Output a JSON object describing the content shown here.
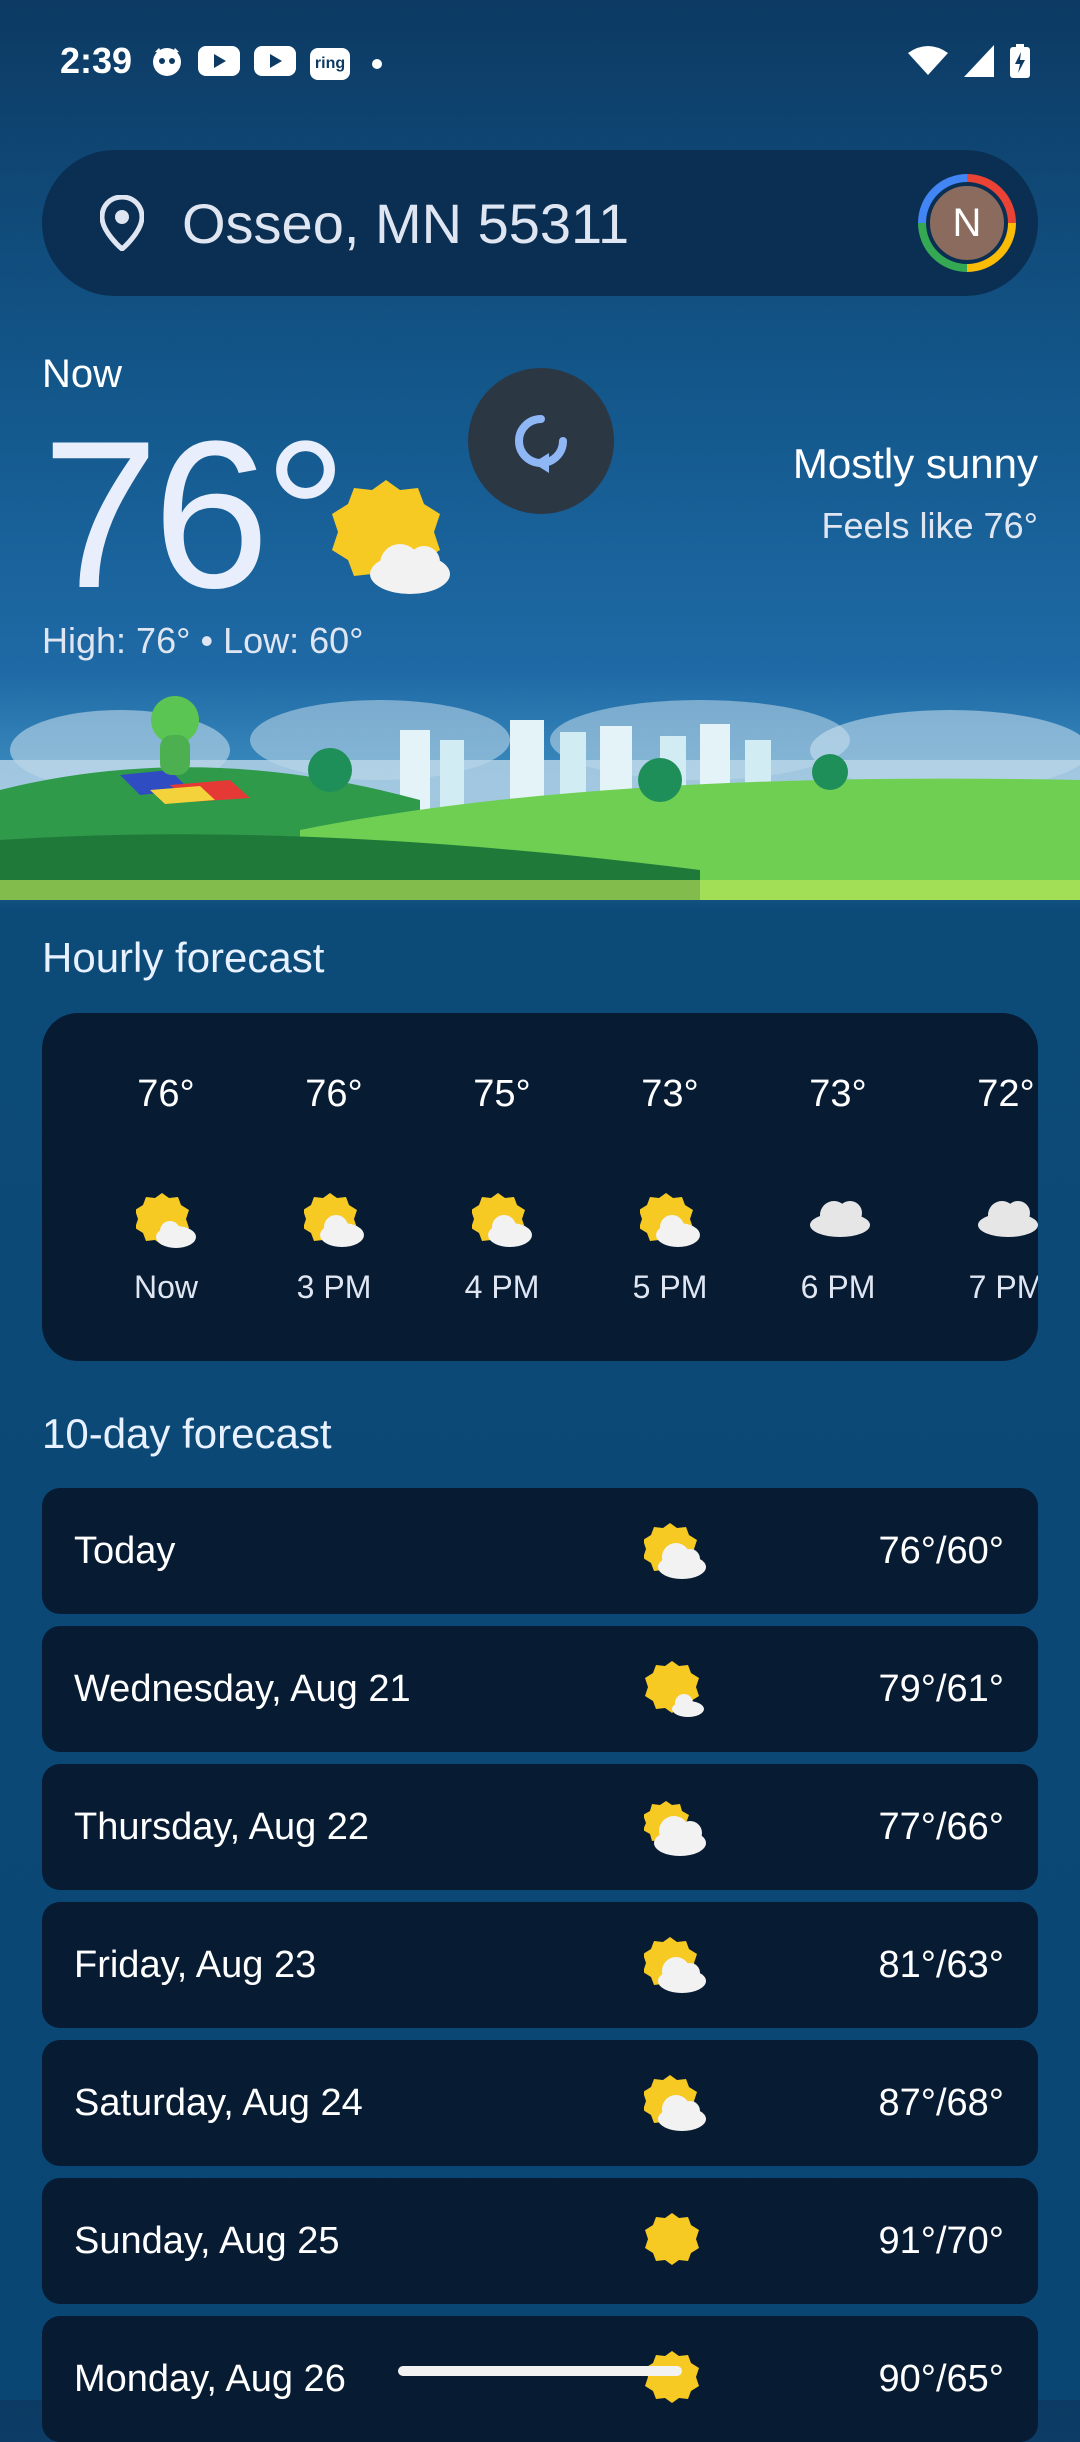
{
  "status_bar": {
    "time": "2:39",
    "notification_icons": [
      "cat-icon",
      "youtube-icon",
      "youtube-icon",
      "ring-icon",
      "dot-icon"
    ],
    "ring_label": "ring",
    "system_icons": [
      "wifi-icon",
      "signal-icon",
      "battery-charging-icon"
    ]
  },
  "search": {
    "location": "Osseo, MN 55311",
    "avatar_letter": "N"
  },
  "current": {
    "now_label": "Now",
    "temperature": "76°",
    "high_low": "High: 76° • Low: 60°",
    "condition": "Mostly sunny",
    "feels_like": "Feels like 76°",
    "icon": "partly-sunny-icon"
  },
  "hourly": {
    "title": "Hourly forecast",
    "items": [
      {
        "temp": "76°",
        "label": "Now",
        "icon": "partly-sunny-icon"
      },
      {
        "temp": "76°",
        "label": "3 PM",
        "icon": "partly-sunny-icon"
      },
      {
        "temp": "75°",
        "label": "4 PM",
        "icon": "partly-sunny-icon"
      },
      {
        "temp": "73°",
        "label": "5 PM",
        "icon": "partly-sunny-icon"
      },
      {
        "temp": "73°",
        "label": "6 PM",
        "icon": "cloud-icon"
      },
      {
        "temp": "72°",
        "label": "7 PM",
        "icon": "cloud-icon"
      }
    ]
  },
  "daily": {
    "title": "10-day forecast",
    "items": [
      {
        "day": "Today",
        "temps": "76°/60°",
        "icon": "partly-cloudy-icon"
      },
      {
        "day": "Wednesday, Aug 21",
        "temps": "79°/61°",
        "icon": "mostly-sunny-icon"
      },
      {
        "day": "Thursday, Aug 22",
        "temps": "77°/66°",
        "icon": "partly-cloudy-icon"
      },
      {
        "day": "Friday, Aug 23",
        "temps": "81°/63°",
        "icon": "partly-cloudy-icon"
      },
      {
        "day": "Saturday, Aug 24",
        "temps": "87°/68°",
        "icon": "partly-cloudy-icon"
      },
      {
        "day": "Sunday, Aug 25",
        "temps": "91°/70°",
        "icon": "sunny-icon"
      },
      {
        "day": "Monday, Aug 26",
        "temps": "90°/65°",
        "icon": "sunny-icon"
      }
    ]
  }
}
